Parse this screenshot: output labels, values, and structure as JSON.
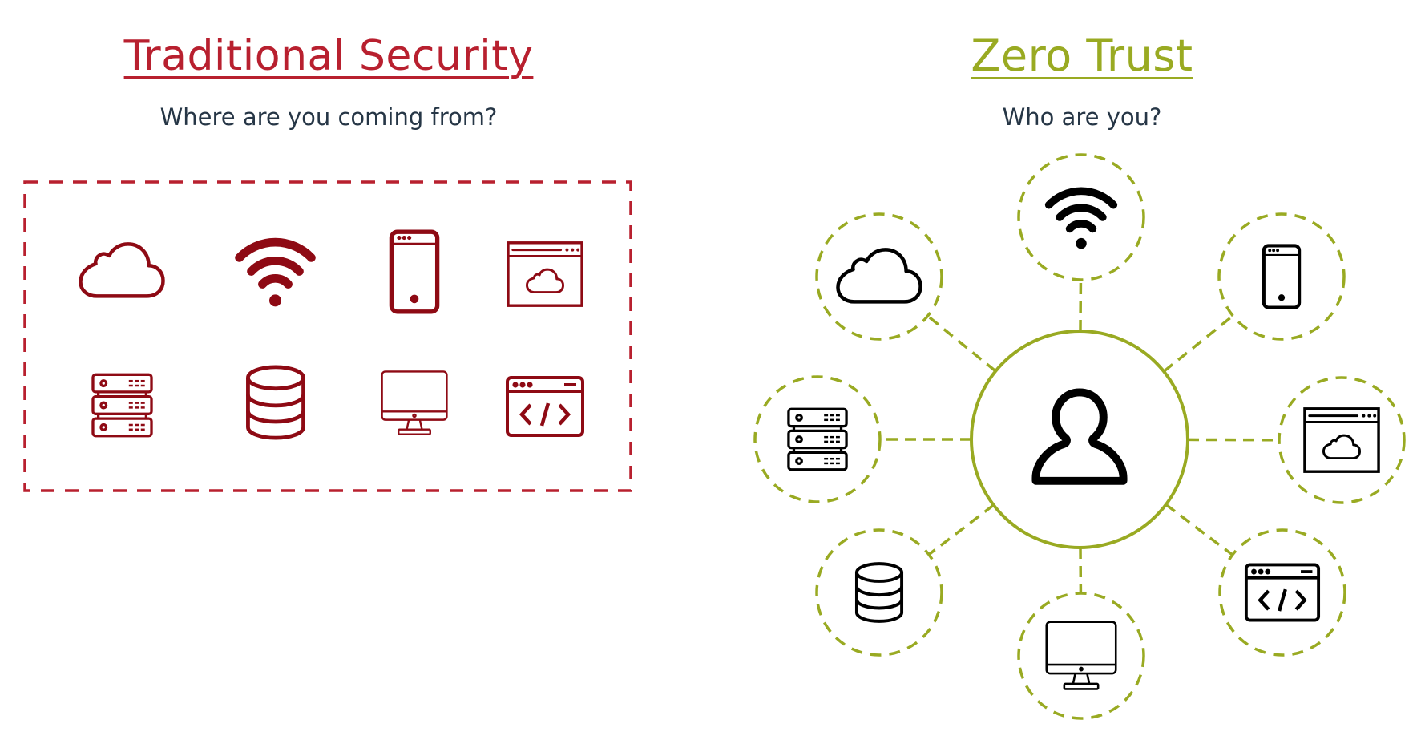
{
  "left_panel": {
    "title": "Traditional Security",
    "subtitle": "Where are you coming from?",
    "color": "#b8202f",
    "icon_color": "#8e0a14",
    "icons": [
      "cloud-icon",
      "wifi-icon",
      "mobile-phone-icon",
      "browser-cloud-icon",
      "server-rack-icon",
      "database-icon",
      "desktop-monitor-icon",
      "code-window-icon"
    ]
  },
  "right_panel": {
    "title": "Zero Trust",
    "subtitle": "Who are you?",
    "color": "#99aa22",
    "icon_color": "#000000",
    "center_icon": "user-icon",
    "satellites": [
      "wifi-icon",
      "mobile-phone-icon",
      "browser-cloud-icon",
      "code-window-icon",
      "desktop-monitor-icon",
      "database-icon",
      "server-rack-icon",
      "cloud-icon"
    ]
  },
  "text_color": "#263646"
}
